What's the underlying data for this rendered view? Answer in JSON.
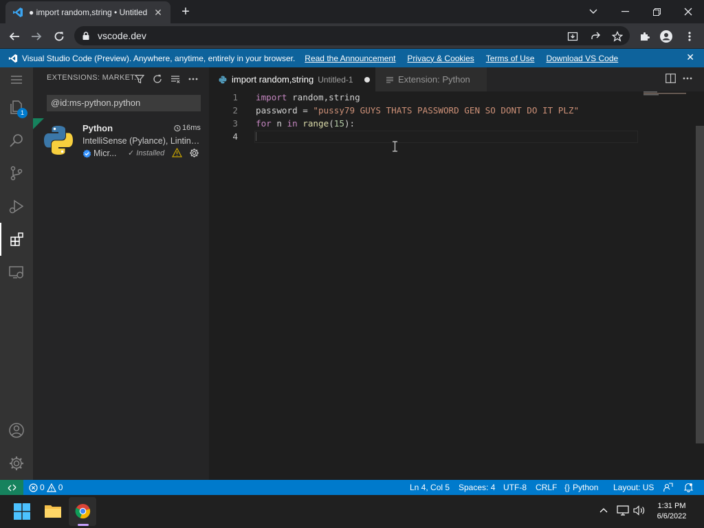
{
  "browser": {
    "tab_title": "● import random,string • Untitled",
    "url": "vscode.dev"
  },
  "banner": {
    "message": "Visual Studio Code (Preview). Anywhere, anytime, entirely in your browser.",
    "links": [
      "Read the Announcement",
      "Privacy & Cookies",
      "Terms of Use",
      "Download VS Code"
    ]
  },
  "activity": {
    "badge": "1"
  },
  "sidebar": {
    "title": "EXTENSIONS: MARKET...",
    "search_value": "@id:ms-python.python",
    "extension": {
      "name": "Python",
      "time": "16ms",
      "description": "IntelliSense (Pylance), Linting, Debugging",
      "publisher": "Micr...",
      "installed": "Installed"
    }
  },
  "editor": {
    "tab1_title": "import random,string",
    "tab1_sub": "Untitled-1",
    "tab2_title": "Extension: Python",
    "line_numbers": [
      "1",
      "2",
      "3",
      "4"
    ],
    "lines": {
      "l1_kw": "import",
      "l1_rest": " random,string",
      "l2_var": "password = ",
      "l2_str": "\"pussy79 GUYS THATS PASSWORD GEN SO DONT DO IT PLZ\"",
      "l3_for": "for",
      "l3_n": " n ",
      "l3_in": "in",
      "l3_sp": " ",
      "l3_range": "range",
      "l3_open": "(",
      "l3_num": "15",
      "l3_close": "):"
    }
  },
  "status": {
    "errors": "0",
    "warnings": "0",
    "position": "Ln 4, Col 5",
    "spaces": "Spaces: 4",
    "encoding": "UTF-8",
    "eol": "CRLF",
    "language": "Python",
    "layout": "Layout: US"
  },
  "taskbar": {
    "time": "1:31 PM",
    "date": "6/6/2022"
  },
  "colors": {
    "accent": "#007acc",
    "banner": "#0e639c",
    "remote": "#16825d"
  }
}
